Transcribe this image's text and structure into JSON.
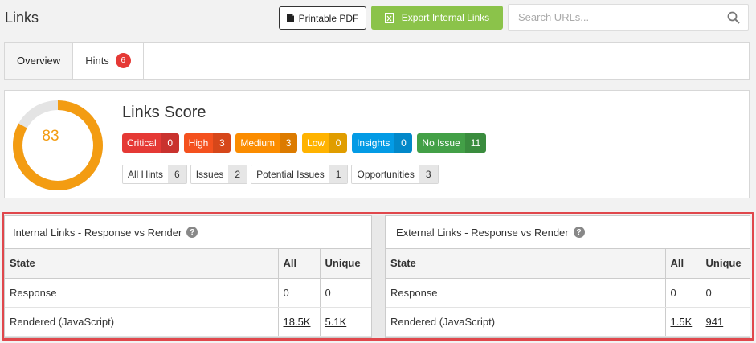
{
  "page": {
    "title": "Links"
  },
  "toolbar": {
    "pdf_label": "Printable PDF",
    "export_label": "Export Internal Links",
    "search_placeholder": "Search URLs..."
  },
  "tabs": [
    {
      "label": "Overview",
      "active": true
    },
    {
      "label": "Hints",
      "badge": "6"
    }
  ],
  "score": {
    "title": "Links Score",
    "value": "83",
    "fraction": 0.83,
    "color": "#f39c12"
  },
  "severity": [
    {
      "label": "Critical",
      "count": "0",
      "color": "#e53935"
    },
    {
      "label": "High",
      "count": "3",
      "color": "#f4511e"
    },
    {
      "label": "Medium",
      "count": "3",
      "color": "#fb8c00"
    },
    {
      "label": "Low",
      "count": "0",
      "color": "#ffb300"
    },
    {
      "label": "Insights",
      "count": "0",
      "color": "#039be5"
    },
    {
      "label": "No Issue",
      "count": "11",
      "color": "#43a047"
    }
  ],
  "hint_filters": [
    {
      "label": "All Hints",
      "count": "6"
    },
    {
      "label": "Issues",
      "count": "2"
    },
    {
      "label": "Potential Issues",
      "count": "1"
    },
    {
      "label": "Opportunities",
      "count": "3"
    }
  ],
  "internal": {
    "title": "Internal Links - Response vs Render",
    "headers": [
      "State",
      "All",
      "Unique"
    ],
    "rows": [
      {
        "state": "Response",
        "all": "0",
        "unique": "0"
      },
      {
        "state": "Rendered (JavaScript)",
        "all": "18.5K",
        "unique": "5.1K"
      }
    ]
  },
  "external": {
    "title": "External Links - Response vs Render",
    "headers": [
      "State",
      "All",
      "Unique"
    ],
    "rows": [
      {
        "state": "Response",
        "all": "0",
        "unique": "0"
      },
      {
        "state": "Rendered (JavaScript)",
        "all": "1.5K",
        "unique": "941"
      }
    ]
  }
}
